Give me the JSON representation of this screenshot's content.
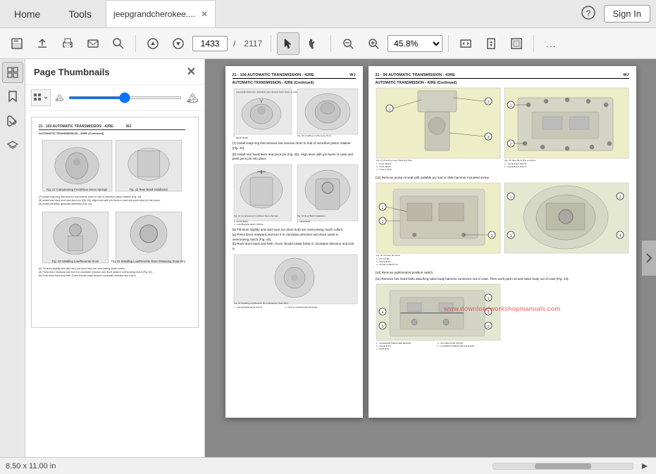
{
  "nav": {
    "home_label": "Home",
    "tools_label": "Tools",
    "tab_filename": "jeepgrandcherokee....",
    "help_icon": "?",
    "signin_label": "Sign In"
  },
  "toolbar": {
    "page_current": "1433",
    "page_total": "2117",
    "zoom_value": "45.8%",
    "more_icon": "...",
    "icons": [
      "save",
      "upload",
      "print",
      "email",
      "search",
      "up",
      "down",
      "cursor",
      "hand",
      "zoom-out",
      "zoom-in",
      "fit-width",
      "fit-page",
      "fit-visible"
    ]
  },
  "thumbnail_panel": {
    "title": "Page Thumbnails",
    "close_icon": "✕"
  },
  "status_bar": {
    "page_size": "8.50 x 11.00 in"
  },
  "main_page": {
    "left_header": "21 - 100  AUTOMATIC TRANSMISSION - 42RE",
    "left_header_right": "WJ",
    "left_subtitle": "AUTOMATIC TRANSMISSION - 42RE (Continued)",
    "right_header": "21 - 94  AUTOMATIC TRANSMISSION - 42RE",
    "right_header_right": "WJ",
    "right_subtitle": "AUTOMATIC TRANSMISSION - 42RE (Continued)",
    "watermark": "www.downloadworkshopmanuals.com",
    "right_note12": "(12)  Remove pump oil seal with suitable pry tool or slide hammer mounted screw.",
    "right_note10": "(10)  Remove park/neutral position switch.",
    "right_note11": "(11)  Remove hex head bolts attaching valve body harness connector out of case. Then work park rod and valve body out of case (Fig. 24).",
    "right_fig21_caption": "Fig. 21 Checking Input Shaft End Play",
    "right_fig21_labels": [
      "1 - TOOL 6259-5",
      "2 - TOOL 6259-6",
      "3 - TOOL C-3339"
    ],
    "right_fig22_caption": "Fig. 22 Oil Filter Removal",
    "right_fig22_labels": [
      "1 - OIL FILTER",
      "2 - VALVE BODY",
      "3 - FILTER SCREWS (2)"
    ],
    "right_fig23_caption": "Fig. 23 Valve Body Bolt Locations",
    "right_fig23_labels": [
      "1 - VALVE BODY BOLTS",
      "2 - VALVE BODY BOLTS"
    ],
    "right_fig24_labels": [
      "1 - GOVERNOR PRESSURE SENSOR",
      "2 - VALVE BODY",
      "3 - PARK ROD",
      "4 - ACCUMULATOR PISTON",
      "5 - GOVERNOR PRESSURE SOLENOID"
    ],
    "left_step7": "(7)  Install snap-ring that secures low reverse drum to hub of overdrive piston retainer (Fig. 44).",
    "left_step8": "(8)  Install rear band lever and pivot pin (Fig. 45). Align lever with pin bores in case and push pivot pin into place.",
    "left_step9": "(9)  Install planetary gearcase assembly (Fig. 44).",
    "left_fig41_caption": "Fig. 41 Compressing Front/Rear Servo Springs",
    "left_fig42_caption": "Fig. 42 Rear Band Installation",
    "left_fig43_caption": "Fig. 43 Installing Low/Reverse Drum",
    "left_fig44_caption": "Fig. 44 Installing Low/Reverse Drum Retaining Snap-Ring",
    "left_step_drum": "(9) Tilt drum slightly and start race (on drum hub) are overrunning clutch rollers.\n(a) Press drum rearward and turn it in clockwise direction and drum seats in overrunning clutch (Fig. 42).\n(b) Rock drum back and forth. Drum should rotate freely in clockwise direction and lock in"
  }
}
